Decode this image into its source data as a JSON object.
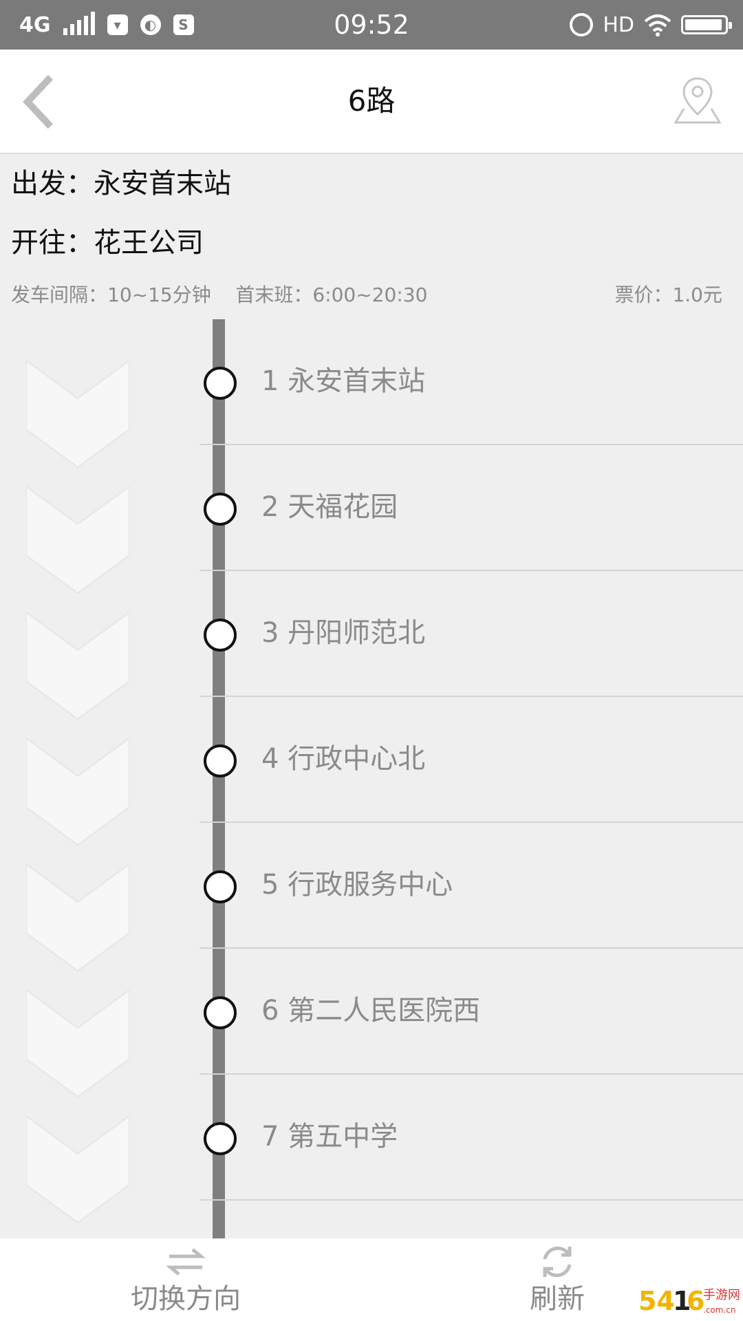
{
  "status_bar": {
    "network": "4G",
    "time": "09:52",
    "hd": "HD",
    "icons": [
      "signal-icon",
      "bag-icon",
      "planet-icon",
      "dollar-icon",
      "alarm-icon",
      "wifi-icon",
      "battery-icon"
    ],
    "battery_level": 0.95
  },
  "header": {
    "title": "6路",
    "back_icon": "chevron-left-icon",
    "map_icon": "map-pin-icon"
  },
  "info": {
    "depart": "出发：永安首末站",
    "destination": "开往：花王公司",
    "interval": "发车间隔：10~15分钟",
    "schedule": "首末班：6:00~20:30",
    "fare": "票价：1.0元"
  },
  "stops": [
    "1 永安首末站",
    "2 天福花园",
    "3 丹阳师范北",
    "4 行政中心北",
    "5 行政服务中心",
    "6 第二人民医院西",
    "7 第五中学"
  ],
  "bottom_bar": {
    "switch_label": "切换方向",
    "refresh_label": "刷新"
  },
  "colors": {
    "status_bar": "#7a7a7a",
    "background": "#efefef",
    "route_line": "#7f7f7f",
    "muted_text": "#8a8a8a"
  }
}
